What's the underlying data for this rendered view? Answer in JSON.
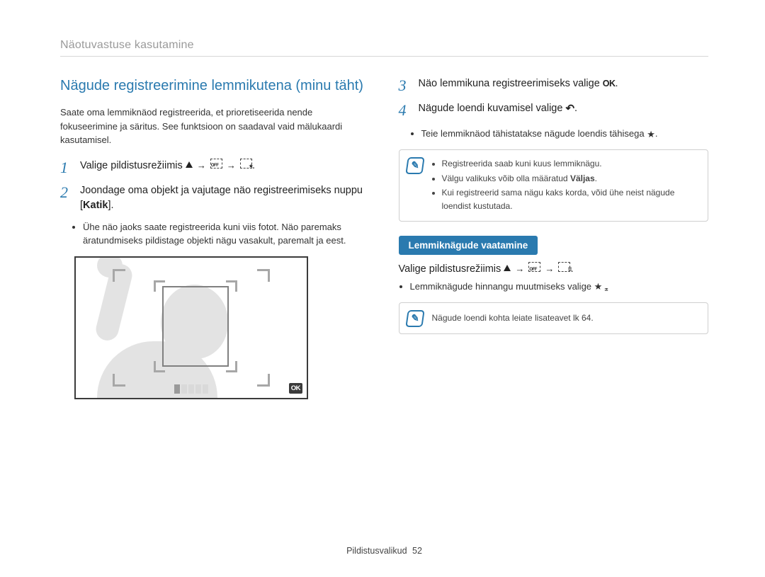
{
  "header": {
    "title": "Näotuvastuse kasutamine"
  },
  "left": {
    "heading": "Nägude registreerimine lemmikutena (minu täht)",
    "intro": "Saate oma lemmiknäod registreerida, et prioretiseerida nende fokuseerimine ja säritus. See funktsioon on saadaval vaid mälukaardi kasutamisel.",
    "step1_prefix": "Valige pildistusrežiimis ",
    "step1_suffix": ".",
    "step2": "Joondage oma objekt ja vajutage näo registreerimiseks nuppu [",
    "step2_bold": "Katik",
    "step2_end": "].",
    "step2_bullet": "Ühe näo jaoks saate registreerida kuni viis fotot. Näo paremaks äratundmiseks pildistage objekti nägu vasakult, paremalt ja eest."
  },
  "right": {
    "step3_prefix": "Näo lemmikuna registreerimiseks valige ",
    "step3_suffix": ".",
    "step4_prefix": "Nägude loendi kuvamisel valige ",
    "step4_suffix": ".",
    "step4_bullet_prefix": "Teie lemmiknäod tähistatakse nägude loendis tähisega ",
    "step4_bullet_suffix": ".",
    "note_items": [
      "Registreerida saab kuni kuus lemmiknägu.",
      "Välgu valikuks võib olla määratud Väljas.",
      "Kui registreerid sama nägu kaks korda, võid ühe neist nägude loendist kustutada."
    ],
    "note_bold": "Väljas",
    "subheading": "Lemmiknägude vaatamine",
    "line_prefix": "Valige pildistusrežiimis ",
    "line_suffix": ".",
    "line_bullet_prefix": "Lemmiknägude hinnangu muutmiseks valige ",
    "line_bullet_suffix": ".",
    "note2": "Nägude loendi kohta leiate lisateavet lk 64."
  },
  "camera": {
    "ok": "OK"
  },
  "footer": {
    "label": "Pildistusvalikud",
    "page": "52"
  }
}
